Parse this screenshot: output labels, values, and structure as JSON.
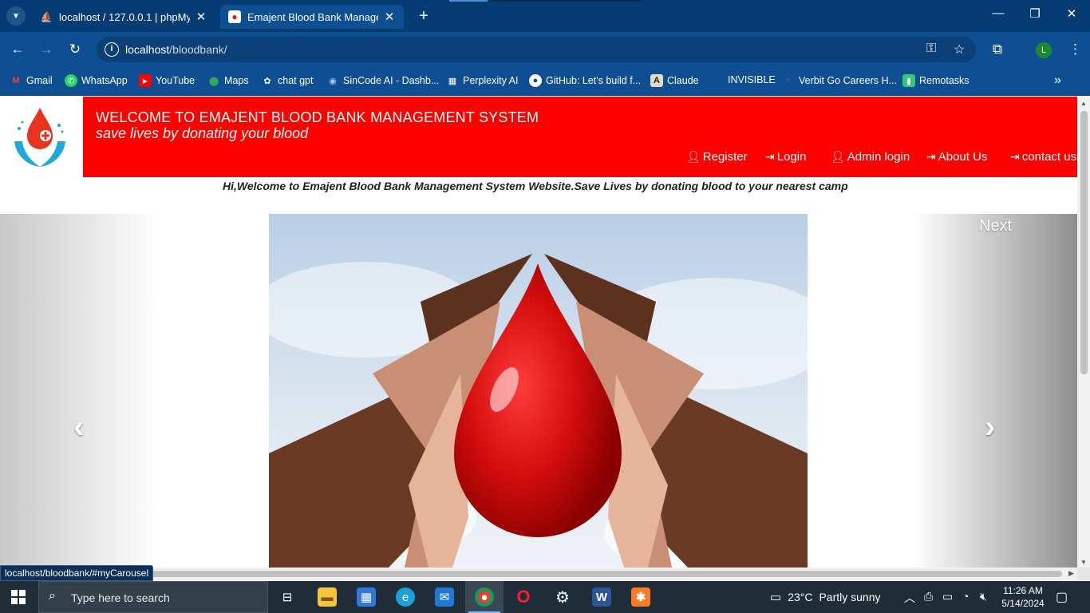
{
  "browser": {
    "tabs": [
      {
        "title": "localhost / 127.0.0.1 | phpMyAdmin",
        "favicon": "phpmyadmin-icon"
      },
      {
        "title": "Emajent Blood Bank Management System",
        "favicon": "blood-bank-icon"
      }
    ],
    "url_host": "localhost",
    "url_path": "/bloodbank/",
    "profile_initial": "L",
    "bookmarks": [
      {
        "label": "Gmail",
        "icon": "gmail-icon"
      },
      {
        "label": "WhatsApp",
        "icon": "whatsapp-icon"
      },
      {
        "label": "YouTube",
        "icon": "youtube-icon"
      },
      {
        "label": "Maps",
        "icon": "maps-icon"
      },
      {
        "label": "chat gpt",
        "icon": "chatgpt-icon"
      },
      {
        "label": "SinCode AI - Dashb...",
        "icon": "sincode-icon"
      },
      {
        "label": "Perplexity AI",
        "icon": "perplexity-icon"
      },
      {
        "label": "GitHub: Let's build f...",
        "icon": "github-icon"
      },
      {
        "label": "Claude",
        "icon": "claude-icon"
      },
      {
        "label": "INVISIBLE",
        "icon": ""
      },
      {
        "label": "Verbit Go Careers H...",
        "icon": "verbit-icon"
      },
      {
        "label": "Remotasks",
        "icon": "remotasks-icon"
      }
    ]
  },
  "site": {
    "title": "WELCOME TO EMAJENT BLOOD BANK MANAGEMENT SYSTEM",
    "subtitle": "save lives by donating your blood",
    "nav": [
      {
        "label": "Register",
        "icon": "user-icon"
      },
      {
        "label": "Login",
        "icon": "login-icon"
      },
      {
        "label": "Admin login",
        "icon": "user-icon"
      },
      {
        "label": "About Us",
        "icon": "login-icon"
      },
      {
        "label": "contact us",
        "icon": "login-icon"
      }
    ],
    "marquee": "Hi,Welcome to Emajent Blood Bank Management System Website.Save Lives by donating blood to your nearest camp",
    "carousel": {
      "next_label": "Next",
      "prev_arrow": "‹",
      "next_arrow": "›"
    },
    "header_color": "#ff0000"
  },
  "status_bar_url": "localhost/bloodbank/#myCarousel",
  "taskbar": {
    "search_placeholder": "Type here to search",
    "weather_temp": "23°C",
    "weather_text": "Partly sunny",
    "time": "11:26 AM",
    "date": "5/14/2024",
    "apps": [
      "task-view-icon",
      "file-explorer-icon",
      "microsoft-store-icon",
      "edge-icon",
      "mail-icon",
      "chrome-icon",
      "opera-icon",
      "settings-icon",
      "word-icon",
      "xampp-icon"
    ]
  }
}
